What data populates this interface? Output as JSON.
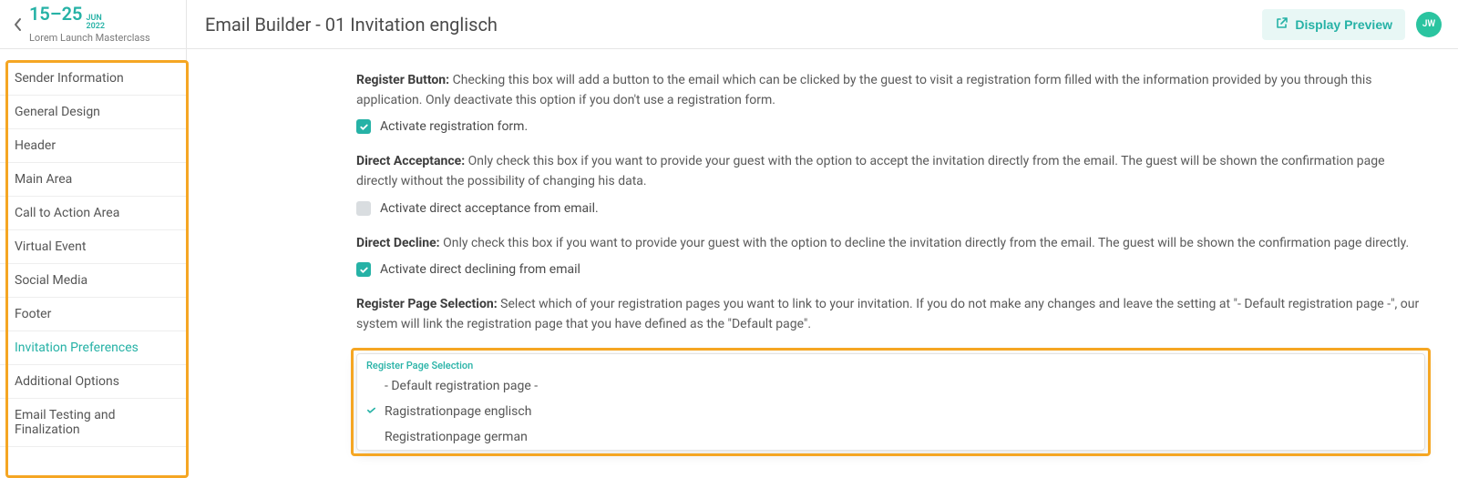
{
  "header": {
    "date_range": "15–25",
    "date_month": "JUN",
    "date_year": "2022",
    "event_name": "Lorem Launch Masterclass",
    "page_title": "Email Builder - 01 Invitation englisch",
    "preview_button": "Display Preview",
    "avatar_initials": "JW"
  },
  "sidebar": {
    "items": [
      {
        "label": "Sender Information",
        "active": false
      },
      {
        "label": "General Design",
        "active": false
      },
      {
        "label": "Header",
        "active": false
      },
      {
        "label": "Main Area",
        "active": false
      },
      {
        "label": "Call to Action Area",
        "active": false
      },
      {
        "label": "Virtual Event",
        "active": false
      },
      {
        "label": "Social Media",
        "active": false
      },
      {
        "label": "Footer",
        "active": false
      },
      {
        "label": "Invitation Preferences",
        "active": true
      },
      {
        "label": "Additional Options",
        "active": false
      },
      {
        "label": "Email Testing and Finalization",
        "active": false
      }
    ]
  },
  "content": {
    "sections": [
      {
        "key": "register_button",
        "label": "Register Button:",
        "desc": "Checking this box will add a button to the email which can be clicked by the guest to visit a registration form filled with the information provided by you through this application. Only deactivate this option if you don't use a registration form.",
        "checkbox_label": "Activate registration form.",
        "checked": true
      },
      {
        "key": "direct_acceptance",
        "label": "Direct Acceptance:",
        "desc": "Only check this box if you want to provide your guest with the option to accept the invitation directly from the email. The guest will be shown the confirmation page directly without the possibility of changing his data.",
        "checkbox_label": "Activate direct acceptance from email.",
        "checked": false
      },
      {
        "key": "direct_decline",
        "label": "Direct Decline:",
        "desc": "Only check this box if you want to provide your guest with the option to decline the invitation directly from the email. The guest will be shown the confirmation page directly.",
        "checkbox_label": "Activate direct declining from email",
        "checked": true
      },
      {
        "key": "register_page_selection",
        "label": "Register Page Selection:",
        "desc": "Select which of your registration pages you want to link to your invitation. If you do not make any changes and leave the setting at \"- Default registration page -\", our system will link the registration page that you have defined as the \"Default page\"."
      }
    ],
    "dropdown": {
      "field_label": "Register Page Selection",
      "options": [
        {
          "label": "- Default registration page -",
          "selected": false
        },
        {
          "label": "Ragistrationpage englisch",
          "selected": true
        },
        {
          "label": "Registrationpage german",
          "selected": false
        }
      ]
    }
  }
}
